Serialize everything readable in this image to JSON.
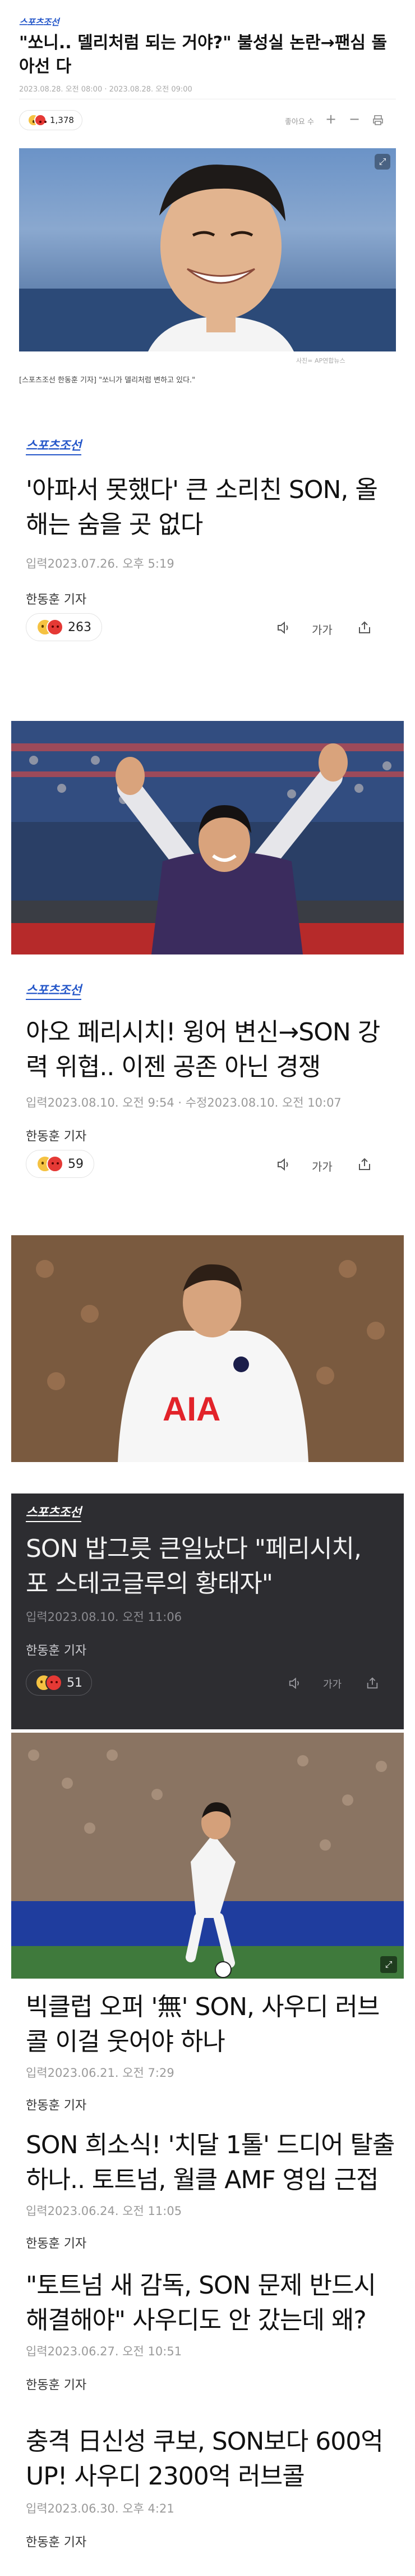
{
  "top_article": {
    "logo": "스포츠조선",
    "headline": "\"쏘니.. 델리처럼 되는 거야?\" 불성실 논란→팬심 돌아선 다",
    "meta": "2023.08.28. 오전 08:00 · 2023.08.28. 오전 09:00",
    "reaction_count": "1,378",
    "reactions_label": "좋아요 수",
    "photo_credit": "사진= AP연합뉴스",
    "caption": "[스포츠조선 한동훈 기자] \"쏘니가 델리처럼 변하고 있다.\""
  },
  "articles": [
    {
      "logo": "스포츠조선",
      "title": "'아파서 못했다' 큰 소리친 SON, 올해는 숨을 곳 없다",
      "date": "입력2023.07.26. 오후 5:19",
      "reporter": "한동훈 기자",
      "reaction_count": "263",
      "font_label": "가가"
    },
    {
      "logo": "스포츠조선",
      "title": "아오 페리시치! 윙어 변신→SON 강력 위협.. 이젠 공존 아닌 경쟁",
      "date": "입력2023.08.10. 오전 9:54 · 수정2023.08.10. 오전 10:07",
      "reporter": "한동훈 기자",
      "reaction_count": "59",
      "font_label": "가가",
      "photo_shirt": "AIA"
    },
    {
      "logo": "스포츠조선",
      "title": "SON 밥그릇 큰일났다 \"페리시치, 포 스테코글루의 황태자\"",
      "date": "입력2023.08.10. 오전 11:06",
      "reporter": "한동훈 기자",
      "reaction_count": "51",
      "font_label": "가가"
    },
    {
      "title": "빅클럽 오퍼 '無' SON, 사우디 러브 콜 이걸 웃어야 하나",
      "date": "입력2023.06.21. 오전 7:29",
      "reporter": "한동훈 기자"
    },
    {
      "title": "SON 희소식! '치달 1톨' 드디어 탈출 하나.. 토트넘, 월클 AMF 영입 근접",
      "date": "입력2023.06.24. 오전 11:05",
      "reporter": "한동훈 기자"
    },
    {
      "title": "\"토트넘 새 감독, SON 문제 반드시 해결해야\" 사우디도 안 갔는데 왜?",
      "date": "입력2023.06.27. 오전 10:51",
      "reporter": "한동훈 기자"
    },
    {
      "title": "충격 日신성 쿠보, SON보다 600억 UP! 사우디 2300억 러브콜",
      "date": "입력2023.06.30. 오후 4:21",
      "reporter": "한동훈 기자"
    }
  ],
  "colors": {
    "brand": "#2557c9",
    "dark_card": "#2d2d31",
    "spurs_navy": "#1b1e4a"
  }
}
